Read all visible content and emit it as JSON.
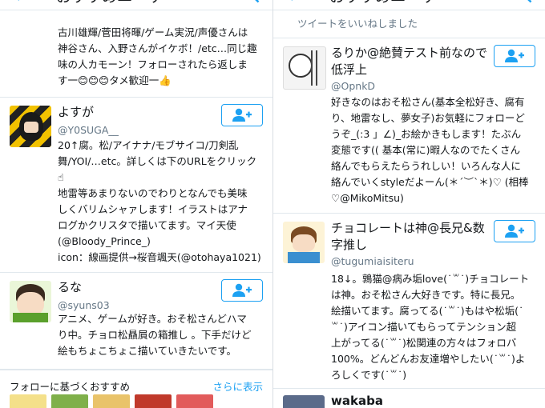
{
  "left": {
    "header": {
      "title": "おすすめユーザー"
    },
    "top_card": {
      "bio": "古川雄輝/菅田将暉/ゲーム実況/声優さんは\n神谷さん、入野さんがイケボ！/etc…同じ趣\n味の人カモーン！フォローされたら返しま\nす一😊😊😊タメ歓迎一👍"
    },
    "users": [
      {
        "name": "よすが",
        "handle": "@Y0SUGA__",
        "bio": "20↑腐。松/アイナナ/モブサイコ/刀剣乱\n舞/YOI/…etc。詳しくは下のURLをクリック\n☝\n地雷等あまりないのでわりとなんでも美味\nしくバリムシャァします！イラストはアナ\nログかクリスタで描いてます。マイ天使\n(@Bloody_Prince_)\nicon：線画提供→桜音颯天(@otohaya1021)"
      },
      {
        "name": "るな",
        "handle": "@syuns03",
        "bio": "アニメ、ゲームが好き。おそ松さんどハマ\nり中。チョロ松贔屓の箱推し 。下手だけど\n絵もちょこちょこ描いていきたいです。"
      }
    ],
    "section": {
      "title": "フォローに基づくおすすめ",
      "more": "さらに表示"
    }
  },
  "right": {
    "header": {
      "title": "おすすめユーザー"
    },
    "top_snippet": "ツイートをいいねしました",
    "users": [
      {
        "name": "るりか@絶賛テスト前なので\n低浮上",
        "handle": "@OpnkD",
        "bio": "好きなのはおそ松さん(基本全松好き、腐有\nり、地雷なし、夢女子)お気軽にフォローど\nうぞ_(:3 」∠)_お絵かきもします！たぶん\n変態です(( 基本(常に)暇人なのでたくさん\n絡んでもらえたらうれしい！いろんな人に\n絡んでいくstyleだよーん(＊´︶`＊)♡ (相棒\n♡@MikoMitsu)"
      },
      {
        "name": "チョコレートは神@長兄&数\n字推し",
        "handle": "@tugumiaisiteru",
        "bio": "18↓。鶉猫@病み垢love(˙꒳˙)チョコレート\nは神。おそ松さん大好きです。特に長兄。\n絵描いてます。腐ってる(˙꒳˙)もはや松垢(˙\n꒳˙)アイコン描いてもらってテンション超\n上がってる(˙꒳˙)松関連の方々はフォロバ\n100%。どんどんお友達増やしたい(˙꒳˙)よ\nろしくです(˙꒳˙)"
      },
      {
        "name": "wakaba"
      }
    ]
  },
  "colors": {
    "accent": "#1da1f2",
    "text": "#14171a",
    "muted": "#657786",
    "border": "#e1e8ed"
  },
  "icons": [
    "back-arrow-icon",
    "search-icon",
    "follow-user-icon"
  ]
}
